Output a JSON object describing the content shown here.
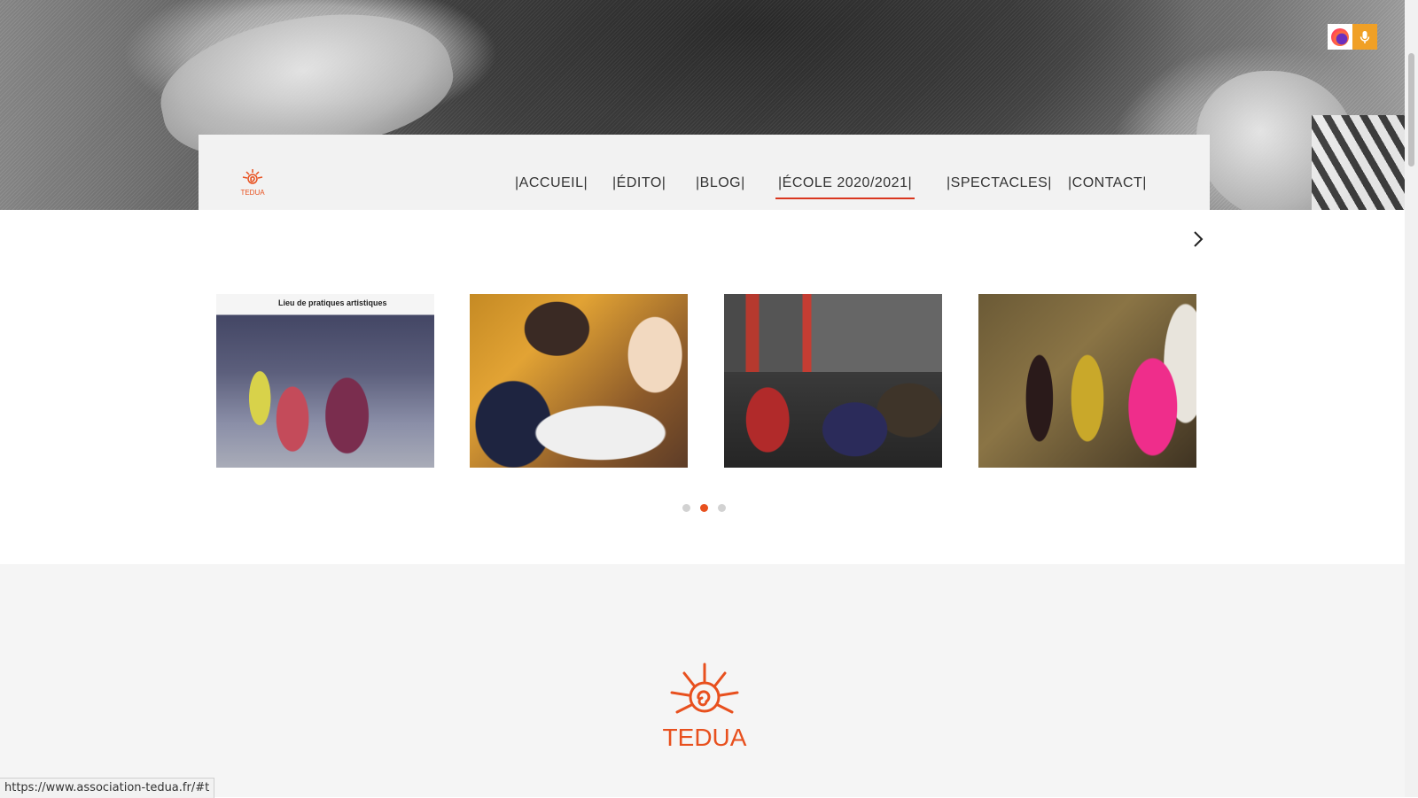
{
  "nav": {
    "logo_text": "TEDUA",
    "items": [
      {
        "label": "|ACCUEIL|"
      },
      {
        "label": "|ÉDITO|"
      },
      {
        "label": "|BLOG|"
      },
      {
        "label": "|ÉCOLE 2020/2021|"
      },
      {
        "label": "|SPECTACLES|"
      },
      {
        "label": "|CONTACT|"
      }
    ],
    "active_index": 3
  },
  "carousel": {
    "next_icon": "chevron-right-icon",
    "photos": [
      {
        "sign_text": "Lieu de pratiques artistiques"
      },
      {},
      {},
      {}
    ],
    "page_count": 3,
    "active_dot": 2
  },
  "footer": {
    "logo_text": "TEDUA"
  },
  "extensions": {
    "icons": [
      "firefox-icon",
      "microphone-icon"
    ]
  },
  "status": {
    "url": "https://www.association-tedua.fr/#t"
  },
  "colors": {
    "brand": "#e8501e",
    "active_underline": "#d9361f",
    "nav_bg": "#f2f2f2",
    "footer_bg": "#f5f5f5"
  }
}
